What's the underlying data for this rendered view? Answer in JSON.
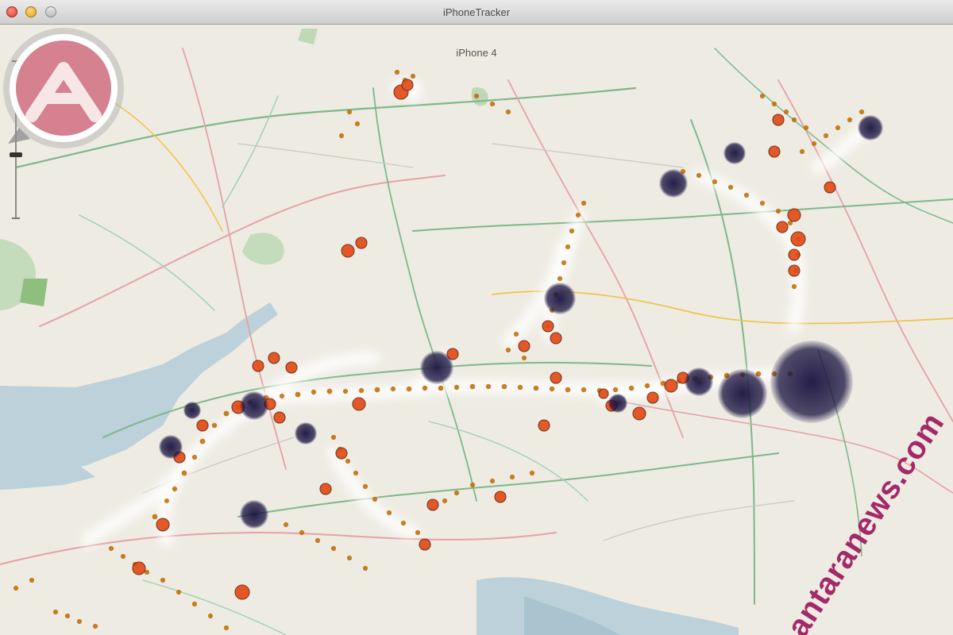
{
  "window": {
    "title": "iPhoneTracker"
  },
  "toolbar": {
    "device_label": "iPhone 4"
  },
  "zoom": {
    "level": 0.6
  },
  "watermark": {
    "text": "www.antaranews.com"
  },
  "colors": {
    "map_land": "#eeebe3",
    "map_water": "#bcd1d9",
    "road_yellow": "#f2c24a",
    "road_green": "#7db88b",
    "road_pink": "#e3a3a3",
    "dot_small": "#c06a00",
    "dot_medium": "#e44b17",
    "dot_large": "#3a1b3f",
    "watermark": "#a01f63"
  },
  "icons": [
    "close-window",
    "minimize-window",
    "zoom-window",
    "zoom-slider",
    "watermark-logo"
  ]
}
